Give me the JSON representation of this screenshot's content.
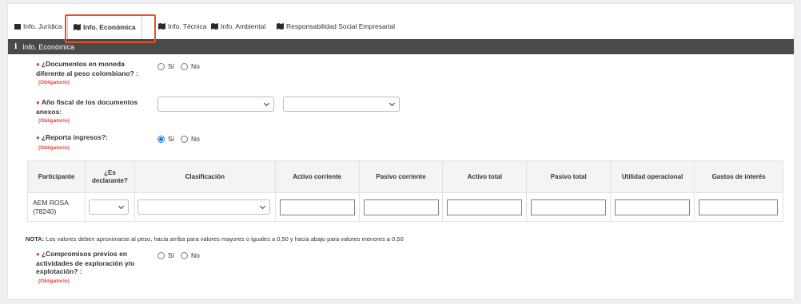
{
  "tabs": [
    {
      "label": "Info. Jurídica",
      "icon": "document-icon"
    },
    {
      "label": "Info. Económica",
      "icon": "map-icon",
      "active": true
    },
    {
      "label": "Info. Técnica",
      "icon": "map-icon"
    },
    {
      "label": "Info. Ambiental",
      "icon": "map-icon"
    },
    {
      "label": "Responsabilidad Social Empresarial",
      "icon": "map-icon"
    }
  ],
  "section": {
    "title": "Info. Económica",
    "icon": "info-icon"
  },
  "fields": {
    "moneda": {
      "label_line1": "¿Documentos en moneda",
      "label_line2": "diferente al peso colombiano? :",
      "required": "(Obligatorio)",
      "opt_yes": "Sí",
      "opt_no": "No",
      "selected": ""
    },
    "anio": {
      "label_line1": "Año fiscal de los documentos",
      "label_line2": "anexos:",
      "required": "(Obligatorio)",
      "select1_value": "",
      "select2_value": ""
    },
    "ingresos": {
      "label_line1": "¿Reporta ingresos?:",
      "required": "(Obligatorio)",
      "opt_yes": "Sí",
      "opt_no": "No",
      "selected": "Sí"
    },
    "compromisos": {
      "label_line1": "¿Compromisos previos en",
      "label_line2": "actividades de exploración y/o",
      "label_line3": "explotación? :",
      "required": "(Obligatorio)",
      "opt_yes": "Sí",
      "opt_no": "No",
      "selected": ""
    }
  },
  "table": {
    "headers": {
      "participante": "Participante",
      "declarante_1": "¿Es",
      "declarante_2": "declarante?",
      "clasificacion": "Clasificación",
      "activo_corriente": "Activo corriente",
      "pasivo_corriente": "Pasivo corriente",
      "activo_total": "Activo total",
      "pasivo_total": "Pasivo total",
      "utilidad": "Utilidad operacional",
      "gastos": "Gastos de interés"
    },
    "rows": [
      {
        "participant_line1": "AEM ROSA",
        "participant_line2": "(78240)"
      }
    ]
  },
  "note": {
    "prefix": "NOTA:",
    "text": " Los valores deben aproximarse al peso, hacia arriba para valores mayores o iguales a 0,50 y hacia abajo para valores menores a 0,50"
  },
  "colors": {
    "header_bg": "#4a4a4a",
    "required": "#e2443b",
    "highlight": "#e8502a",
    "radio_accent": "#1a73e8"
  }
}
